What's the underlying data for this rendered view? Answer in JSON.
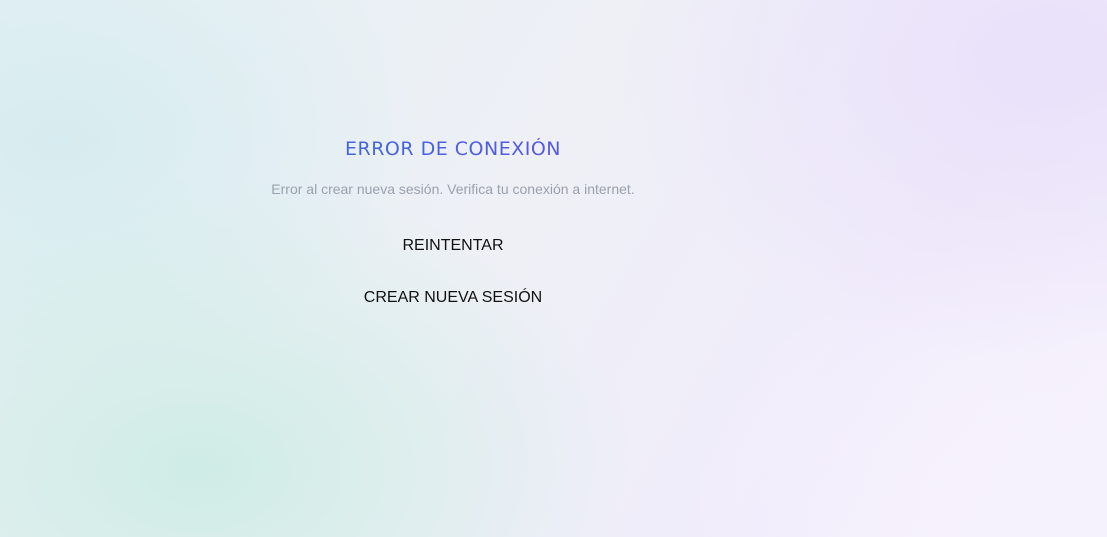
{
  "error": {
    "title": "ERROR DE CONEXIÓN",
    "message": "Error al crear nueva sesión. Verifica tu conexión a internet."
  },
  "actions": {
    "retry_label": "REINTENTAR",
    "new_session_label": "CREAR NUEVA SESIÓN"
  },
  "colors": {
    "title_gradient_start": "#2f7ad6",
    "title_gradient_end": "#7a45e3",
    "message_text": "#9aa1ad",
    "button_text": "#111111"
  }
}
